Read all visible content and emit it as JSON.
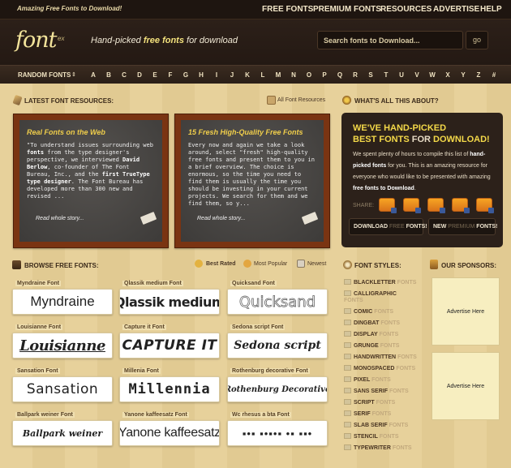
{
  "topbar": {
    "tagline": "Amazing Free Fonts to Download!",
    "nav": [
      "FREE FONTS",
      "PREMIUM FONTS",
      "RESOURCES",
      "ADVERTISE",
      "HELP"
    ]
  },
  "header": {
    "logo_main": "font",
    "logo_sub": "ex",
    "slogan_pre": "Hand-picked ",
    "slogan_bold": "free fonts",
    "slogan_post": " for download",
    "search_placeholder": "Search fonts to Download...",
    "go_label": "go"
  },
  "alphabar": {
    "random_label": "RANDOM FONTS",
    "arrow": "⇕",
    "letters": [
      "A",
      "B",
      "C",
      "D",
      "E",
      "F",
      "G",
      "H",
      "I",
      "J",
      "K",
      "L",
      "M",
      "N",
      "O",
      "P",
      "Q",
      "R",
      "S",
      "T",
      "U",
      "V",
      "W",
      "X",
      "Y",
      "Z",
      "#"
    ]
  },
  "resources": {
    "heading": "LATEST FONT RESOURCES:",
    "all_link": "All Font Resources",
    "boards": [
      {
        "title": "Real Fonts on the Web",
        "text_1": "\"To understand issues surrounding web ",
        "bold_1": "fonts",
        "text_2": " from the type designer's perspective, we interviewed ",
        "bold_2": "David Berlow",
        "text_3": ", co-founder of The Font Bureau, Inc., and the ",
        "bold_3": "first TrueType type designer",
        "text_4": ". The Font Bureau has developed more than 300 new and revised ...",
        "more": "Read whole story..."
      },
      {
        "title": "15 Fresh High-Quality Free Fonts",
        "text_1": "Every now and again we take a look around, select \"fresh\" high-quality free fonts and present them to you in a brief overview. The choice is enormous, so the time you need to find them is usually the time you should be investing in your current projects. We search for them and we find them, so y...",
        "more": "Read whole story..."
      }
    ]
  },
  "about": {
    "heading": "WHAT'S ALL THIS ABOUT?",
    "title_line1": "WE'VE HAND-PICKED",
    "title_line2_a": "BEST FONTS ",
    "title_line2_b": "FOR",
    "title_line2_c": " DOWNLOAD!",
    "p_1": "We spent plenty of hours to compile this list of ",
    "p_bold_1": "hand-picked fonts",
    "p_2": " for you. This is an amazing resource for everyone who would like to be presented with amazing ",
    "p_bold_2": "free fonts to Download",
    "p_3": ".",
    "share_label": "SHARE:",
    "btn_download_a": "DOWNLOAD ",
    "btn_download_b": "FREE",
    "btn_download_c": " FONTS!",
    "btn_new_a": "NEW ",
    "btn_new_b": "PREMIUM",
    "btn_new_c": " FONTS!"
  },
  "browse": {
    "heading": "BROWSE FREE FONTS:",
    "tabs": [
      "Best Rated",
      "Most Popular",
      "Newest"
    ],
    "fonts": [
      {
        "label": "Myndraine Font",
        "sample": "Myndraine"
      },
      {
        "label": "Qlassik medium Font",
        "sample": "Qlassik medium"
      },
      {
        "label": "Quicksand Font",
        "sample": "Quicksand"
      },
      {
        "label": "Louisianne Font",
        "sample": "Louisianne"
      },
      {
        "label": "Capture it Font",
        "sample": "CAPTURE IT"
      },
      {
        "label": "Sedona script Font",
        "sample": "Sedona script"
      },
      {
        "label": "Sansation Font",
        "sample": "Sansation"
      },
      {
        "label": "Millenia Font",
        "sample": "Millennia"
      },
      {
        "label": "Rothenburg decorative Font",
        "sample": "Rothenburg Decorative"
      },
      {
        "label": "Ballpark weiner Font",
        "sample": "Ballpark weiner"
      },
      {
        "label": "Yanone kaffeesatz Font",
        "sample": "Yanone kaffeesatz"
      },
      {
        "label": "Wc rhesus a bta Font",
        "sample": "▪•▪ ▪•▪•▪ •▪ ▪▪•"
      }
    ]
  },
  "styles": {
    "heading": "FONT STYLES:",
    "suffix": "FONTS",
    "items": [
      "BLACKLETTER",
      "CALLIGRAPHIC",
      "COMIC",
      "DINGBAT",
      "DISPLAY",
      "GRUNGE",
      "HANDWRITTEN",
      "MONOSPACED",
      "PIXEL",
      "SANS SERIF",
      "SCRIPT",
      "SERIF",
      "SLAB SERIF",
      "STENCIL",
      "TYPEWRITER"
    ]
  },
  "sponsors": {
    "heading": "OUR SPONSORS:",
    "ad_1": "Advertise Here",
    "ad_2": "Advertise Here"
  },
  "colors": {
    "accent_yellow": "#f4d949",
    "dark_brown": "#2c211a",
    "board_frame": "#7a3412",
    "share_orange": "#f7a523"
  }
}
